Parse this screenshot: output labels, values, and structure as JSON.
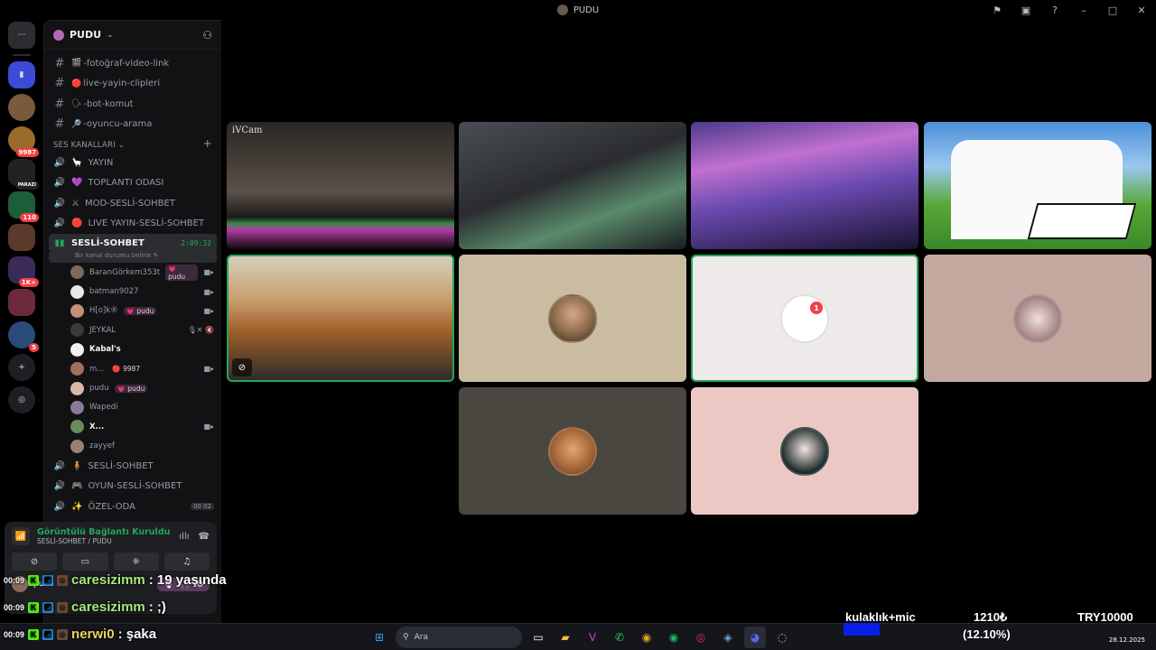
{
  "window": {
    "title": "PUDU"
  },
  "server_rail": {
    "badges": [
      "9987",
      "PARAZI",
      "110",
      "1K+",
      "5"
    ]
  },
  "guild": {
    "name": "PUDU"
  },
  "text_channels": [
    {
      "emoji": "🎬",
      "name": "-fotoğraf-video-link"
    },
    {
      "emoji": "🔴",
      "name": "live-yayin-clipleri"
    },
    {
      "emoji": "🗣",
      "name": "-bot-komut"
    },
    {
      "emoji": "🔎",
      "name": "-oyuncu-arama"
    }
  ],
  "voice_category": "SES KANALLARI",
  "voice_channels_top": [
    {
      "emoji": "🦙",
      "name": "YAYIN"
    },
    {
      "emoji": "💜",
      "name": "TOPLANTI ODASI"
    },
    {
      "emoji": "⚔",
      "name": "MOD-SESLİ-SOHBET"
    },
    {
      "emoji": "🔴",
      "name": "LIVE YAYIN-SESLİ-SOHBET"
    }
  ],
  "active_voice": {
    "name": "SESLİ-SOHBET",
    "timer": "2:09:32",
    "status_placeholder": "Bir kanal durumu belirle"
  },
  "members": [
    {
      "name": "BaranGörkem353t",
      "tag": "💗 pudu",
      "cam": true
    },
    {
      "name": "batman9027",
      "tag": "",
      "cam": true
    },
    {
      "name": "H[o]k®",
      "tag": "💗 pudu",
      "cam": true
    },
    {
      "name": "JEYKAL",
      "tag": "",
      "cam": false,
      "icons": "🎙✕ 🔇"
    },
    {
      "name": "Kabal's",
      "tag": "",
      "cam": false,
      "bold": true
    },
    {
      "name": "m...",
      "tag": "🔴 9987",
      "cam": true
    },
    {
      "name": "pudu",
      "tag": "💗 pudu",
      "cam": false
    },
    {
      "name": "Wapedi",
      "tag": "",
      "cam": false
    },
    {
      "name": "X...",
      "tag": "",
      "cam": true,
      "bold": true
    },
    {
      "name": "zayyef",
      "tag": "",
      "cam": false
    }
  ],
  "voice_channels_bottom": [
    {
      "emoji": "🧍",
      "name": "SESLİ-SOHBET"
    },
    {
      "emoji": "🎮",
      "name": "OYUN-SESLİ-SOHBET"
    },
    {
      "emoji": "✨",
      "name": "ÖZEL-ODA",
      "counts": "00 02"
    }
  ],
  "voice_panel": {
    "title": "Görüntülü Bağlantı Kuruldu",
    "subtitle": "SESLİ-SOHBET / PUDU",
    "user": "pudu"
  },
  "tiles": [
    {
      "label": "iVCam"
    }
  ],
  "chat": [
    {
      "time": "00:09",
      "user": "caresizimm",
      "message": ": 19 yaşında"
    },
    {
      "time": "00:09",
      "user": "caresizimm",
      "message": ": ;)"
    },
    {
      "time": "00:09",
      "user": "nerwi0",
      "message": ": şaka"
    }
  ],
  "overlay": {
    "label": "kulaklık+mic",
    "amount": "1210₺",
    "percent": "(12.10%)",
    "goal": "TRY10000",
    "progress_fraction": 0.121
  },
  "taskbar": {
    "search_placeholder": "Ara",
    "date": "28.12.2025"
  },
  "colors": {
    "speaking_outline": "#23a55a",
    "discord_red": "#f23f43",
    "progress_bar": "#0a1fe6"
  }
}
